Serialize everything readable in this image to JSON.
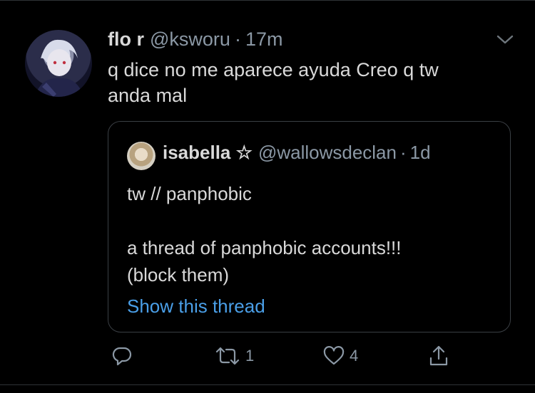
{
  "tweet": {
    "author_name": "flo r",
    "author_handle": "@ksworu",
    "separator": "·",
    "time": "17m",
    "text": "q dice no me aparece ayuda Creo q tw\nanda mal"
  },
  "quoted": {
    "author_name": "isabella ☆",
    "author_handle": "@wallowsdeclan",
    "separator": "·",
    "time": "1d",
    "text": "tw // panphobic\n\na thread of panphobic accounts!!!\n(block them)",
    "show_thread_label": "Show this thread"
  },
  "actions": {
    "reply_icon": "reply-icon",
    "retweet_icon": "retweet-icon",
    "retweet_count": "1",
    "like_icon": "heart-icon",
    "like_count": "4",
    "share_icon": "share-icon"
  },
  "colors": {
    "background": "#000000",
    "text": "#d9d9d9",
    "secondary": "#8b98a5",
    "link": "#4a9fe8",
    "border": "#3a3f44"
  }
}
